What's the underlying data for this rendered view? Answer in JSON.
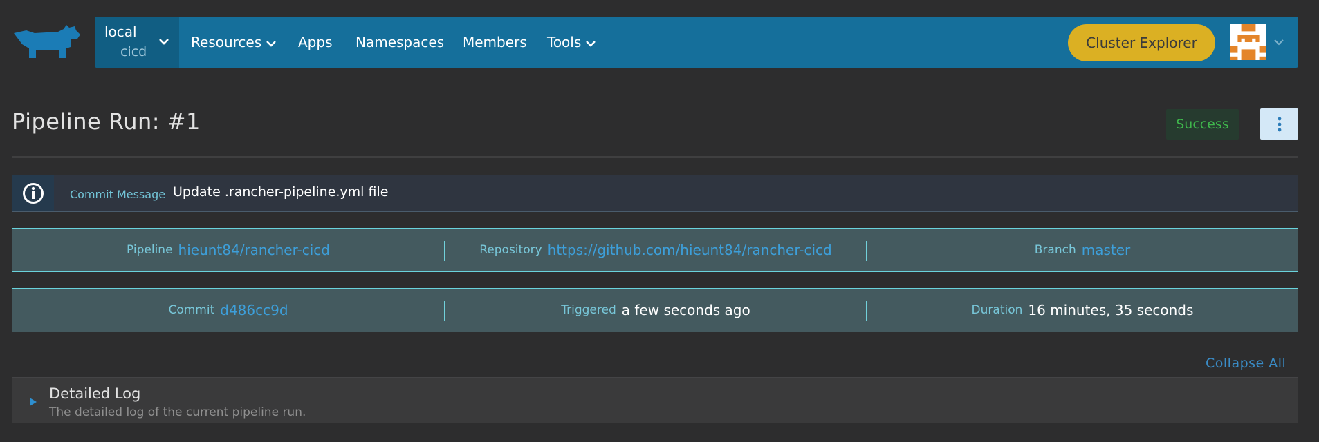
{
  "colors": {
    "topbar": "#156f9b",
    "accent_link": "#3d9fda",
    "success": "#3fb64c",
    "explorer_button": "#dbb023"
  },
  "header": {
    "logo_icon": "rancher-logo-icon",
    "cluster": "local",
    "project": "cicd",
    "nav": {
      "resources": "Resources",
      "apps": "Apps",
      "namespaces": "Namespaces",
      "members": "Members",
      "tools": "Tools"
    },
    "cluster_explorer": "Cluster Explorer",
    "avatar_icon": "user-avatar-icon"
  },
  "page": {
    "title": "Pipeline Run: #1",
    "status": "Success",
    "more_icon": "vertical-ellipsis-icon"
  },
  "commit_message": {
    "icon": "info-icon",
    "label": "Commit Message",
    "text": "Update .rancher-pipeline.yml file"
  },
  "info_row_1": {
    "pipeline_label": "Pipeline",
    "pipeline_value": "hieunt84/rancher-cicd",
    "repository_label": "Repository",
    "repository_value": "https://github.com/hieunt84/rancher-cicd",
    "branch_label": "Branch",
    "branch_value": "master"
  },
  "info_row_2": {
    "commit_label": "Commit",
    "commit_value": "d486cc9d",
    "triggered_label": "Triggered",
    "triggered_value": "a few seconds ago",
    "duration_label": "Duration",
    "duration_value": "16 minutes, 35 seconds"
  },
  "collapse_all": "Collapse All",
  "log_panel": {
    "title": "Detailed Log",
    "description": "The detailed log of the current pipeline run."
  }
}
